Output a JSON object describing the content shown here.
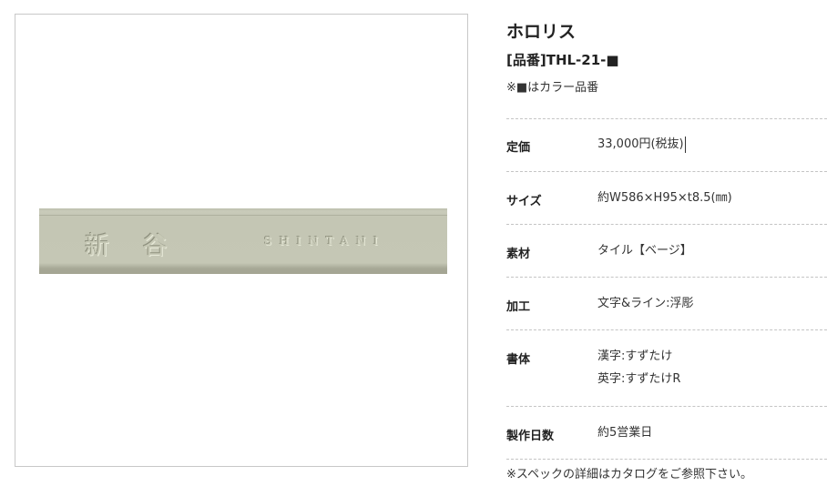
{
  "product": {
    "image_kanji": "新 谷",
    "image_roman": "SHINTANI",
    "title": "ホロリス",
    "code": "[品番]THL-21-■",
    "color_note": "※■はカラー品番"
  },
  "specs": [
    {
      "label": "定価",
      "values": [
        "33,000円(税抜)"
      ]
    },
    {
      "label": "サイズ",
      "values": [
        "約W586×H95×t8.5(㎜)"
      ]
    },
    {
      "label": "素材",
      "values": [
        "タイル【ベージ】"
      ]
    },
    {
      "label": "加工",
      "values": [
        "文字&ライン:浮彫"
      ]
    },
    {
      "label": "書体",
      "values": [
        "漢字:すずたけ",
        "英字:すずたけR"
      ]
    },
    {
      "label": "製作日数",
      "values": [
        "約5営業日"
      ]
    }
  ],
  "footnote": "※スペックの詳細はカタログをご参照下さい。"
}
